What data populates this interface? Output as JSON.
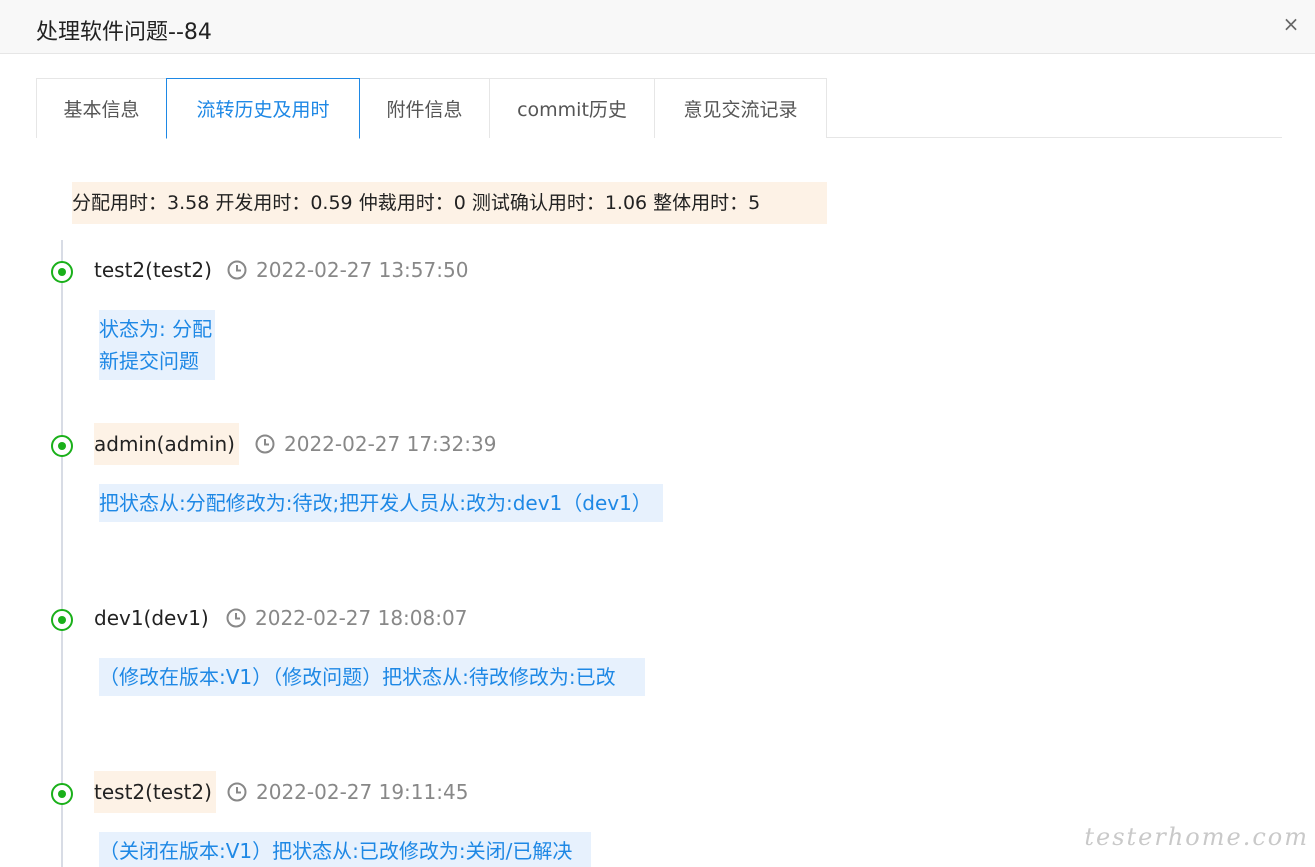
{
  "dialog": {
    "title": "处理软件问题--84",
    "close_label": "×"
  },
  "tabs": [
    {
      "label": "基本信息",
      "active": false
    },
    {
      "label": "流转历史及用时",
      "active": true
    },
    {
      "label": "附件信息",
      "active": false
    },
    {
      "label": "commit历史",
      "active": false
    },
    {
      "label": "意见交流记录",
      "active": false
    }
  ],
  "summary": "分配用时：3.58 开发用时：0.59 仲裁用时：0 测试确认用时：1.06 整体用时：5",
  "timeline": [
    {
      "user": "test2(test2)",
      "time": "2022-02-27 13:57:50",
      "highlight_user": false,
      "lines": [
        "状态为: 分配",
        "新提交问题"
      ]
    },
    {
      "user": "admin(admin)",
      "time": "2022-02-27 17:32:39",
      "highlight_user": true,
      "lines": [
        "把状态从:分配修改为:待改;把开发人员从:改为:dev1（dev1）"
      ]
    },
    {
      "user": "dev1(dev1)",
      "time": "2022-02-27 18:08:07",
      "highlight_user": false,
      "lines": [
        "（修改在版本:V1）（修改问题）把状态从:待改修改为:已改"
      ]
    },
    {
      "user": "test2(test2)",
      "time": "2022-02-27 19:11:45",
      "highlight_user": true,
      "lines": [
        "（关闭在版本:V1）把状态从:已改修改为:关闭/已解决"
      ]
    }
  ],
  "watermark": "testerhome.com",
  "colors": {
    "accent": "#1e88e5",
    "dot": "#1ab01a",
    "highlight": "#fdf2e6",
    "note_bg": "#e7f1fd"
  }
}
